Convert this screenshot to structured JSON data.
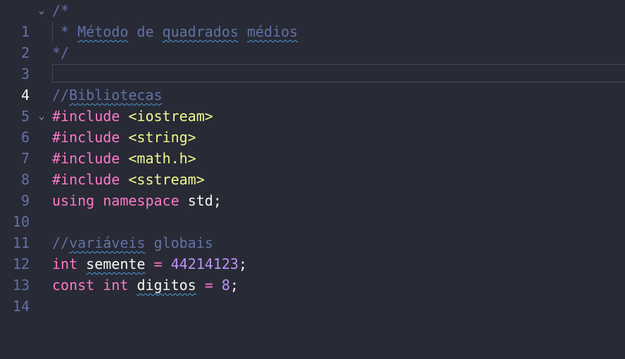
{
  "editor": {
    "current_line": 4,
    "lines": [
      {
        "num": "1",
        "fold": "chevron-down",
        "tokens": [
          "/*"
        ]
      },
      {
        "num": "2",
        "tokens": [
          " * ",
          "Método",
          " de ",
          "quadrados",
          " ",
          "médios"
        ]
      },
      {
        "num": "3",
        "tokens": [
          "*/"
        ]
      },
      {
        "num": "4",
        "tokens": []
      },
      {
        "num": "5",
        "tokens": [
          "//",
          "Bibliotecas"
        ]
      },
      {
        "num": "6",
        "fold": "chevron-down",
        "tokens": [
          "#include",
          " ",
          "<iostream>"
        ]
      },
      {
        "num": "7",
        "tokens": [
          "#include",
          " ",
          "<string>"
        ]
      },
      {
        "num": "8",
        "tokens": [
          "#include",
          " ",
          "<math.h>"
        ]
      },
      {
        "num": "9",
        "tokens": [
          "#include",
          " ",
          "<sstream>"
        ]
      },
      {
        "num": "10",
        "tokens": [
          "using",
          " ",
          "namespace",
          " ",
          "std",
          ";"
        ]
      },
      {
        "num": "11",
        "tokens": []
      },
      {
        "num": "12",
        "tokens": [
          "//",
          "variáveis",
          " globais"
        ]
      },
      {
        "num": "13",
        "tokens": [
          "int",
          " ",
          "semente",
          " ",
          "=",
          " ",
          "44214123",
          ";"
        ]
      },
      {
        "num": "14",
        "tokens": [
          "const",
          " ",
          "int",
          " ",
          "digitos",
          " ",
          "=",
          " ",
          "8",
          ";"
        ]
      }
    ]
  },
  "theme": {
    "background": "#282a36",
    "comment": "#6272a4",
    "keyword": "#ff79c6",
    "string": "#f1fa8c",
    "number": "#bd93f9",
    "foreground": "#f8f8f2",
    "spell_squiggle": "#4b9cd3"
  }
}
